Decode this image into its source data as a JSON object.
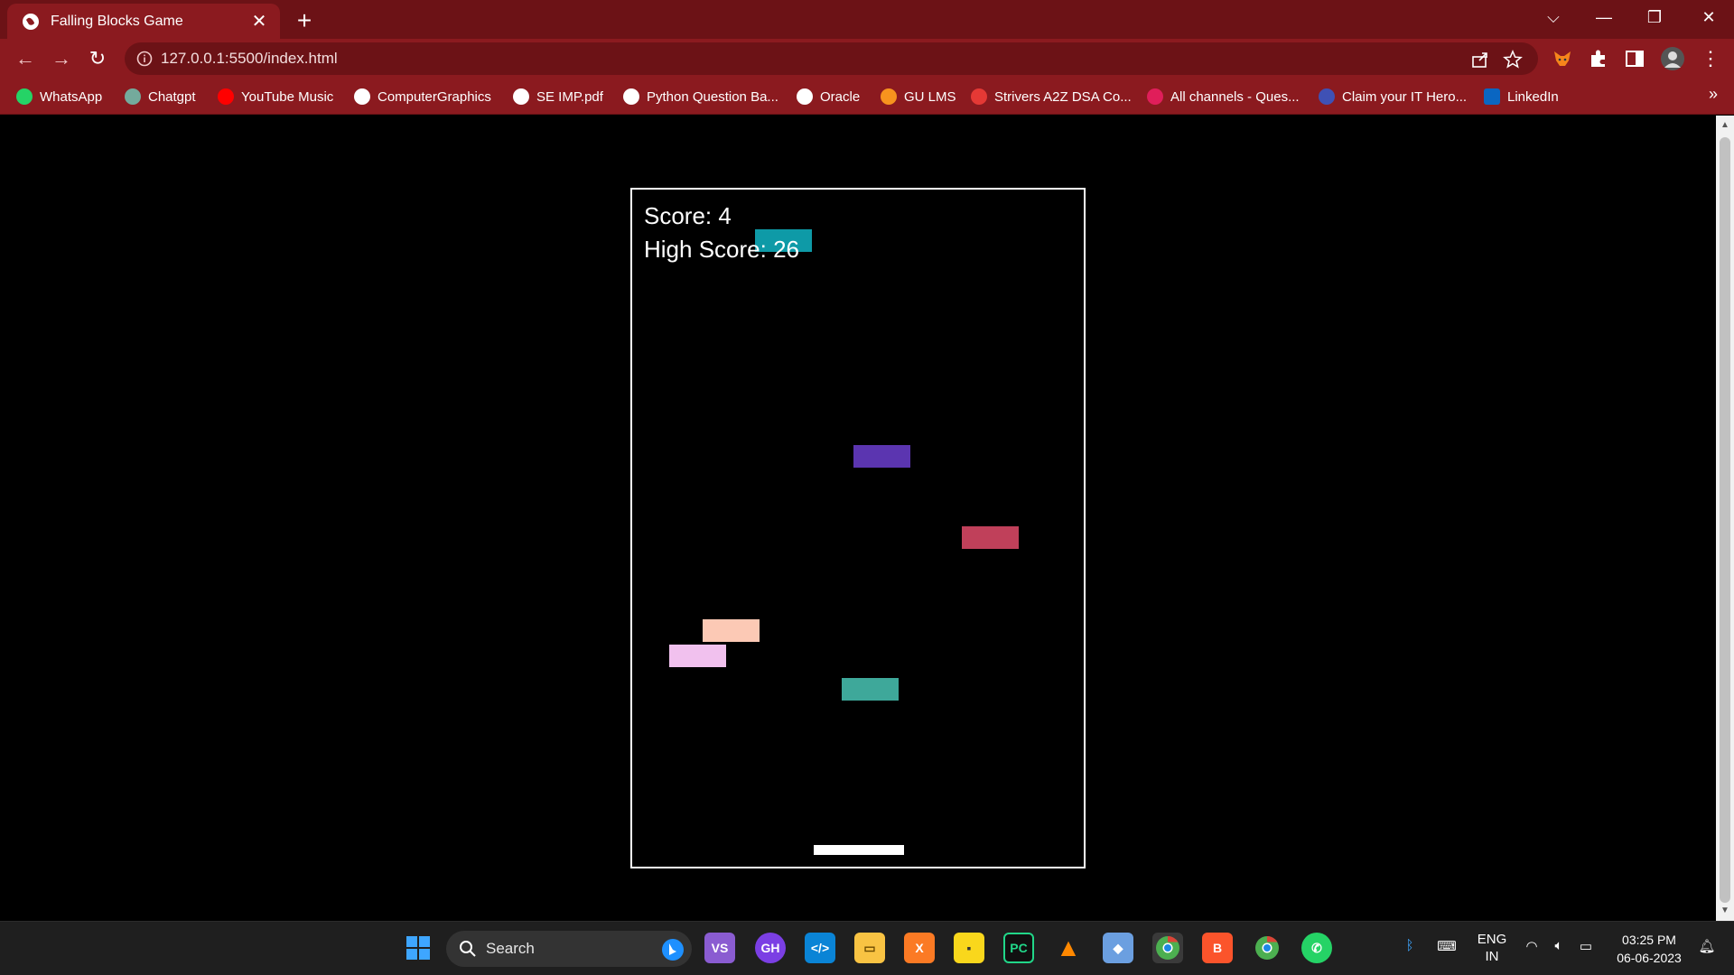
{
  "browser": {
    "tab_title": "Falling Blocks Game",
    "tab_close": "✕",
    "new_tab": "+",
    "window_controls": {
      "dropdown": "⌵",
      "minimize": "—",
      "restore": "❐",
      "close": "✕"
    },
    "url": "127.0.0.1:5500/index.html",
    "bookmarks": [
      {
        "label": "WhatsApp",
        "icon": "whatsapp-icon",
        "color": "#25d366"
      },
      {
        "label": "Chatgpt",
        "icon": "chatgpt-icon",
        "color": "#74aa9c"
      },
      {
        "label": "YouTube Music",
        "icon": "youtube-music-icon",
        "color": "#ff0000"
      },
      {
        "label": "ComputerGraphics",
        "icon": "globe-icon",
        "color": "#ffffff"
      },
      {
        "label": "SE IMP.pdf",
        "icon": "globe-icon",
        "color": "#ffffff"
      },
      {
        "label": "Python Question Ba...",
        "icon": "globe-icon",
        "color": "#ffffff"
      },
      {
        "label": "Oracle",
        "icon": "globe-icon",
        "color": "#ffffff"
      },
      {
        "label": "GU LMS",
        "icon": "gu-lms-icon",
        "color": "#f7931e"
      },
      {
        "label": "Strivers A2Z DSA Co...",
        "icon": "tuf-icon",
        "color": "#e53935"
      },
      {
        "label": "All channels - Ques...",
        "icon": "slack-icon",
        "color": "#e01e5a"
      },
      {
        "label": "Claim your IT Hero...",
        "icon": "hero-icon",
        "color": "#3f51b5"
      },
      {
        "label": "LinkedIn",
        "icon": "linkedin-icon",
        "color": "#0a66c2"
      }
    ],
    "bookmarks_more": "»"
  },
  "game": {
    "score_text": "Score: 4",
    "high_score_text": "High Score: 26",
    "blocks": [
      {
        "name": "teal",
        "color": "#0e9aa7"
      },
      {
        "name": "purple",
        "color": "#5b35b0"
      },
      {
        "name": "red",
        "color": "#c0405a"
      },
      {
        "name": "peach",
        "color": "#fcc9b5"
      },
      {
        "name": "pink",
        "color": "#f1c1ee"
      },
      {
        "name": "green",
        "color": "#3ea89a"
      }
    ],
    "paddle_color": "#ffffff"
  },
  "taskbar": {
    "search_placeholder": "Search",
    "apps": [
      {
        "name": "windows-start-icon",
        "color": "#3ea6ff"
      },
      {
        "name": "bing-icon",
        "color": "#1e90ff"
      },
      {
        "name": "visual-studio-icon",
        "color": "#8a5cd1"
      },
      {
        "name": "github-desktop-icon",
        "color": "#7b3fe4"
      },
      {
        "name": "vscode-icon",
        "color": "#0a84d6"
      },
      {
        "name": "file-explorer-icon",
        "color": "#f8c343"
      },
      {
        "name": "xampp-icon",
        "color": "#fb7a24"
      },
      {
        "name": "sticky-notes-icon",
        "color": "#f9d71c"
      },
      {
        "name": "pycharm-icon",
        "color": "#21d789"
      },
      {
        "name": "vlc-icon",
        "color": "#ff8800"
      },
      {
        "name": "git-icon",
        "color": "#6b9fe0"
      },
      {
        "name": "chrome-icon",
        "color": "#4caf50"
      },
      {
        "name": "brave-icon",
        "color": "#fb542b"
      },
      {
        "name": "chrome-profile-icon",
        "color": "#4caf50"
      },
      {
        "name": "whatsapp-icon",
        "color": "#25d366"
      }
    ],
    "lang_top": "ENG",
    "lang_bottom": "IN",
    "time": "03:25 PM",
    "date": "06-06-2023"
  }
}
